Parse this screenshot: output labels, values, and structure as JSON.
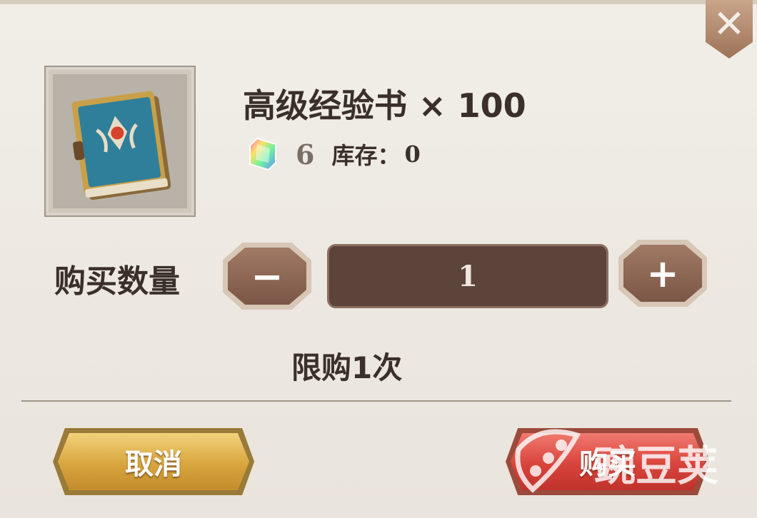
{
  "dialog": {
    "close_icon": "close-icon"
  },
  "item": {
    "icon": "exp-book-icon",
    "title": "高级经验书 × 100",
    "currency_icon": "rainbow-gem-icon",
    "price": "6",
    "stock_label": "库存：",
    "stock_value": "0"
  },
  "quantity": {
    "label": "购买数量",
    "value": "1",
    "minus_label": "−",
    "plus_label": "+"
  },
  "limit_text": "限购1次",
  "actions": {
    "cancel_label": "取消",
    "buy_label": "购买"
  },
  "watermark": {
    "text": "豌豆荚"
  },
  "colors": {
    "background": "#ece8e1",
    "text": "#3a2f2a",
    "qty_field": "#5c443b",
    "cancel_button": "#d8a53e",
    "buy_button": "#d8443c"
  }
}
